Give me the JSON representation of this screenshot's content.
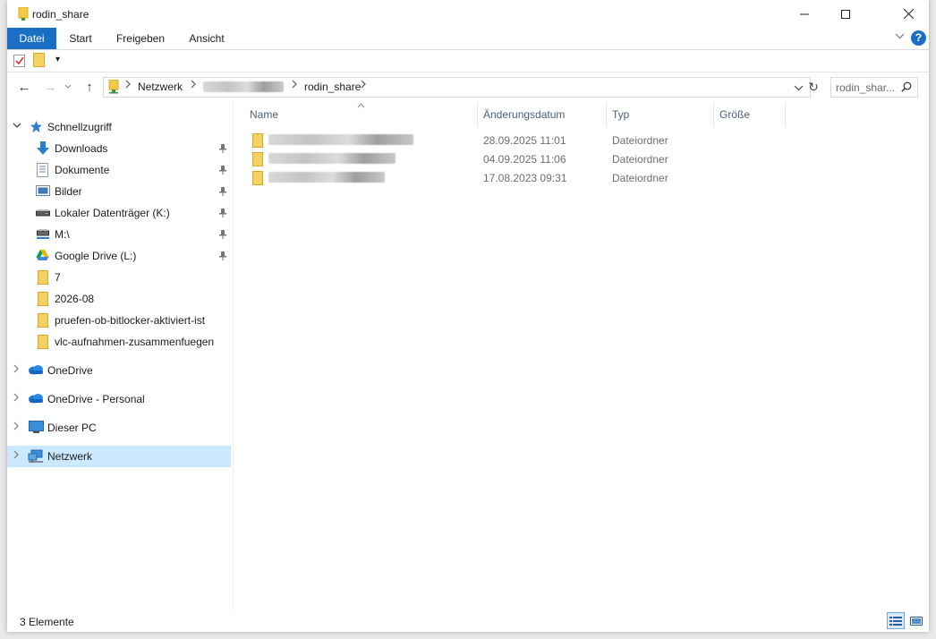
{
  "window": {
    "title": "rodin_share",
    "minimize_glyph": "—",
    "maximize_glyph": "☐",
    "close_glyph": "✕"
  },
  "ribbon": {
    "tabs": [
      "Datei",
      "Start",
      "Freigeben",
      "Ansicht"
    ],
    "active_tab": "Datei",
    "accent_color": "#1a6fc4",
    "expand_glyph": "∨",
    "help_glyph": "?"
  },
  "qat": {
    "items": [
      "properties-icon",
      "new-folder-icon"
    ],
    "dropdown_glyph": "▾"
  },
  "address": {
    "back_glyph": "←",
    "forward_glyph": "→",
    "up_glyph": "↑",
    "segments": [
      "Netzwerk",
      "rodin_share"
    ],
    "chevron": ">",
    "dropdown_glyph": "∨",
    "refresh_glyph": "↻"
  },
  "search": {
    "placeholder": "rodin_shar...",
    "icon": "search-icon"
  },
  "nav": {
    "quick_access": "Schnellzugriff",
    "pinned": [
      {
        "label": "Downloads",
        "icon": "download-arrow-icon"
      },
      {
        "label": "Dokumente",
        "icon": "document-icon"
      },
      {
        "label": "Bilder",
        "icon": "pictures-icon"
      },
      {
        "label": "Lokaler Datenträger (K:)",
        "icon": "drive-icon"
      },
      {
        "label": "M:\\",
        "icon": "network-drive-icon"
      },
      {
        "label": "Google Drive (L:)",
        "icon": "google-drive-icon"
      }
    ],
    "recent_folders": [
      "7",
      "2026-08",
      "pruefen-ob-bitlocker-aktiviert-ist",
      "vlc-aufnahmen-zusammenfuegen"
    ],
    "roots": [
      {
        "label": "OneDrive",
        "icon": "onedrive-cloud-icon"
      },
      {
        "label": "OneDrive - Personal",
        "icon": "onedrive-cloud-icon"
      },
      {
        "label": "Dieser PC",
        "icon": "computer-icon"
      },
      {
        "label": "Netzwerk",
        "icon": "network-icon",
        "selected": true
      }
    ],
    "expand_glyph": "∨",
    "collapse_glyph": ">"
  },
  "list": {
    "sort_indicator": "^",
    "columns": [
      "Name",
      "Änderungsdatum",
      "Typ",
      "Größe"
    ],
    "rows": [
      {
        "date": "28.09.2025 11:01",
        "type": "Dateiordner"
      },
      {
        "date": "04.09.2025 11:06",
        "type": "Dateiordner"
      },
      {
        "date": "17.08.2023 09:31",
        "type": "Dateiordner"
      }
    ]
  },
  "status": {
    "count": "3 Elemente"
  }
}
